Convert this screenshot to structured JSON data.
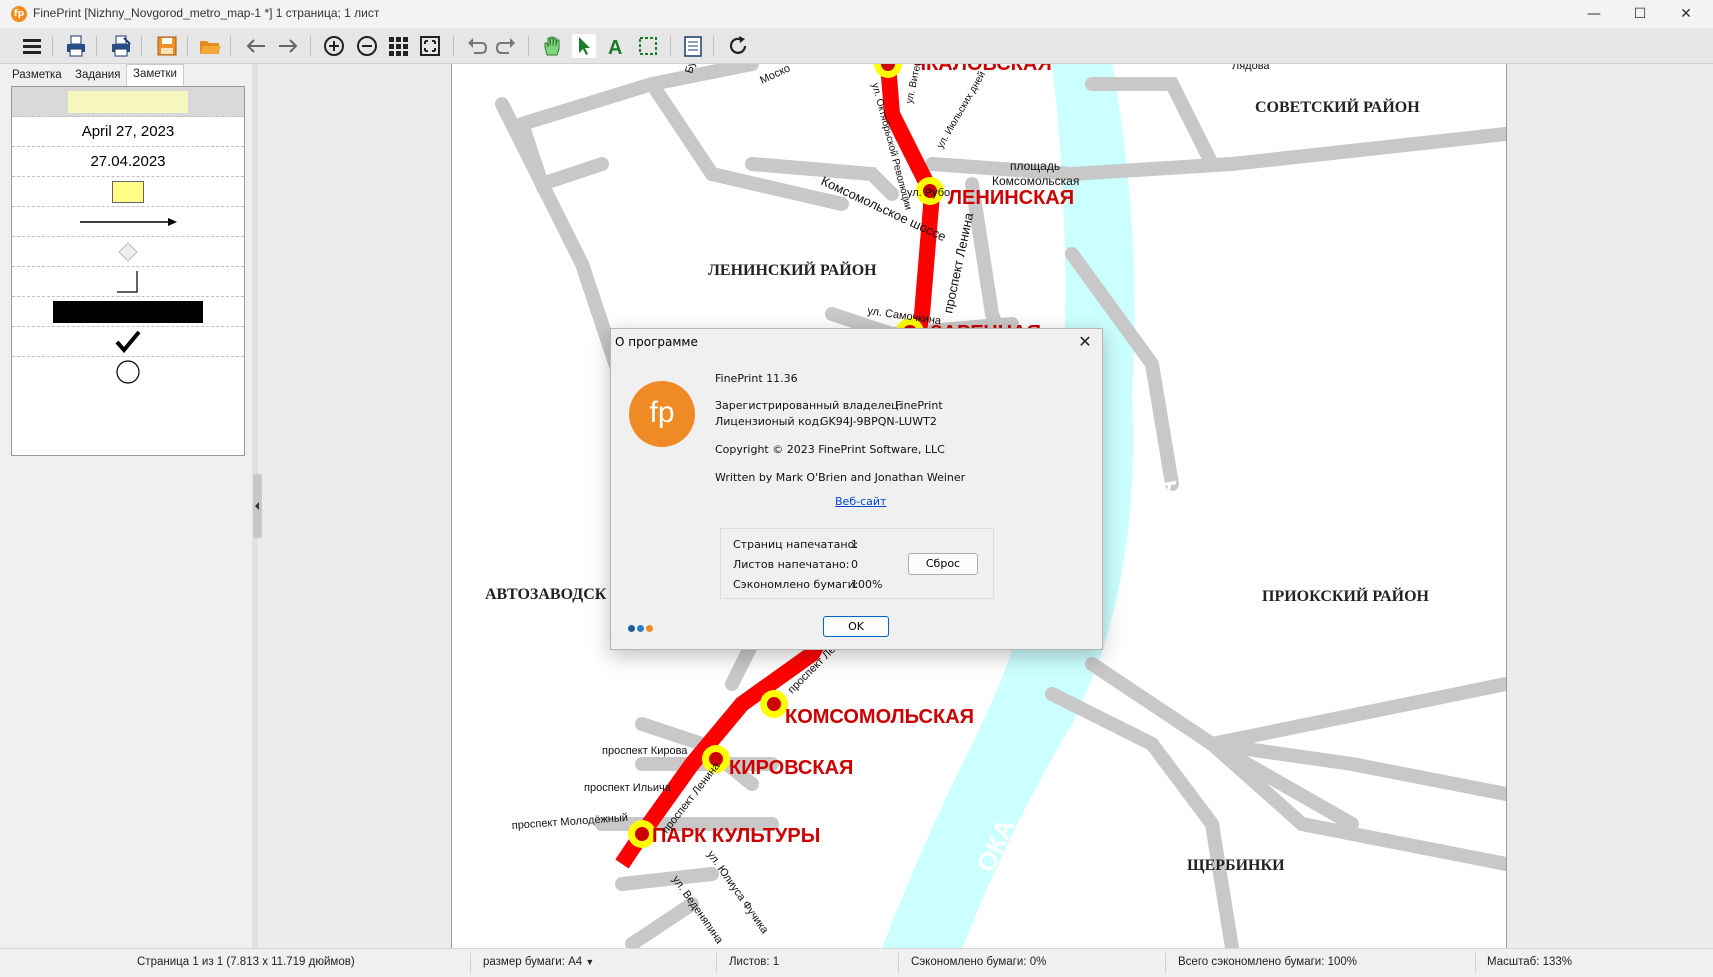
{
  "window": {
    "title": "FinePrint [Nizhny_Novgorod_metro_map-1 *] 1 страница; 1 лист",
    "minimize": "—",
    "maximize": "☐",
    "close": "✕",
    "icon_glyph": "fp"
  },
  "toolbar": {
    "icons": [
      "menu-icon",
      "print-icon",
      "print-settings-icon",
      "save-icon",
      "open-folder-icon",
      "back-icon",
      "forward-icon",
      "zoom-in-icon",
      "zoom-out-icon",
      "grid-icon",
      "fit-page-icon",
      "undo-icon",
      "redo-icon",
      "hand-tool-icon",
      "select-tool-icon",
      "text-tool-icon",
      "marquee-tool-icon",
      "notes-icon",
      "refresh-icon"
    ]
  },
  "left_panel": {
    "tabs": [
      {
        "label": "Разметка"
      },
      {
        "label": "Задания"
      },
      {
        "label": "Заметки",
        "selected": true
      }
    ],
    "notes": {
      "date_long": "April 27, 2023",
      "date_short": "27.04.2023"
    }
  },
  "map": {
    "districts": [
      "СОВЕТСКИЙ РАЙОН",
      "ЛЕНИНСКИЙ РАЙОН",
      "АВТОЗАВОДСК",
      "ПРИОКСКИЙ РАЙОН",
      "ЩЕРБИНКИ"
    ],
    "stations": [
      "ЛЕНИНСКАЯ",
      "ЗАРЕЧНАЯ",
      "КОМСОМОЛЬСКАЯ",
      "КИРОВСКАЯ",
      "ПАРК КУЛЬТУРЫ",
      "ЧКАЛОВСКАЯ"
    ],
    "streets": {
      "komsomolskoe": "Комсомольское шоссе",
      "rubo": "ул. Рубо",
      "samochkina": "ул. Самочкина",
      "ploshad1": "площадь",
      "ploshad2": "Комсомольская",
      "lenina1": "проспект Ленина",
      "lenina2": "проспект Ленина",
      "lenina3": "проспект Ленина",
      "kirova": "проспект Кирова",
      "ilicha": "проспект Ильича",
      "molodezhny": "проспект Молодёжный",
      "fuchika": "ул. Юлиуса Фучика",
      "vedenyapina": "ул. Веденяпина",
      "oktrev": "ул. Октябрьской Революции",
      "vitebskaya": "ул. Витебская",
      "iyulskih": "ул. Июльских дней",
      "lyadova": "Лядова",
      "moskov": "Моско",
      "bu": "Бу"
    },
    "river": [
      "ОКА",
      "ОКА"
    ],
    "colors": {
      "line": "#ff0000",
      "station": "#ffff00",
      "station_dot": "#cc0000",
      "river": "#ccffff",
      "roads": "#c8c8c8",
      "label_red": "#cc0000"
    }
  },
  "dialog": {
    "title": "О программе",
    "product": "FinePrint 11.36",
    "owner_label": "Зарегистрированный владелец:",
    "owner_value": "FinePrint",
    "license_label": "Лицензионый код:",
    "license_value": "GK94J-9BPQN-LUWT2",
    "copyright": "Copyright © 2023 FinePrint Software, LLC",
    "written_by": "Written by Mark O'Brien and Jonathan Weiner",
    "website": "Веб-сайт",
    "logo_text": "fp",
    "stats": {
      "pages_label": "Страниц напечатано:",
      "pages_value": "1",
      "sheets_label": "Листов напечатано:",
      "sheets_value": "0",
      "saved_label": "Сэкономлено бумаги:",
      "saved_value": "100%"
    },
    "reset_button": "Сброс",
    "ok_button": "OK",
    "close": "✕",
    "dot_colors": [
      "#1f5a99",
      "#2f7cc0",
      "#f08a24"
    ]
  },
  "statusbar": {
    "page_info": "Страница 1 из 1 (7.813 x 11.719 дюймов)",
    "paper_size": "размер бумаги: A4",
    "sheets": "Листов: 1",
    "saved": "Сэкономлено бумаги: 0%",
    "total_saved": "Всего сэкономлено бумаги: 100%",
    "zoom": "Масштаб: 133%"
  }
}
